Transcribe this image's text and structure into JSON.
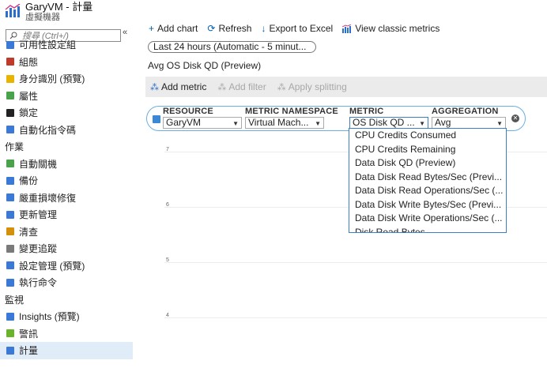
{
  "app": {
    "title": "GaryVM - 計量",
    "subtitle": "虛擬機器"
  },
  "search": {
    "placeholder": "搜尋 (Ctrl+/)"
  },
  "collapse_glyph": "«",
  "sidebar": {
    "items": [
      {
        "type": "item",
        "label": "可用性設定組",
        "icon": "availability-icon",
        "color": "#3a7ad6"
      },
      {
        "type": "item",
        "label": "組態",
        "icon": "configuration-icon",
        "color": "#c0392b"
      },
      {
        "type": "item",
        "label": "身分識別 (預覽)",
        "icon": "identity-icon",
        "color": "#e8b400"
      },
      {
        "type": "item",
        "label": "屬性",
        "icon": "properties-icon",
        "color": "#4aa24a"
      },
      {
        "type": "item",
        "label": "鎖定",
        "icon": "lock-icon",
        "color": "#222222"
      },
      {
        "type": "item",
        "label": "自動化指令碼",
        "icon": "automation-script-icon",
        "color": "#3a7ad6"
      },
      {
        "type": "group",
        "label": "作業"
      },
      {
        "type": "item",
        "label": "自動關機",
        "icon": "auto-shutdown-icon",
        "color": "#4aa24a"
      },
      {
        "type": "item",
        "label": "備份",
        "icon": "backup-icon",
        "color": "#3a7ad6"
      },
      {
        "type": "item",
        "label": "嚴重損壞修復",
        "icon": "disaster-recovery-icon",
        "color": "#3a7ad6"
      },
      {
        "type": "item",
        "label": "更新管理",
        "icon": "update-management-icon",
        "color": "#3a7ad6"
      },
      {
        "type": "item",
        "label": "清查",
        "icon": "inventory-icon",
        "color": "#d4900a"
      },
      {
        "type": "item",
        "label": "變更追蹤",
        "icon": "change-tracking-icon",
        "color": "#7a7a7a"
      },
      {
        "type": "item",
        "label": "設定管理 (預覽)",
        "icon": "configuration-management-icon",
        "color": "#3a7ad6"
      },
      {
        "type": "item",
        "label": "執行命令",
        "icon": "run-command-icon",
        "color": "#3a7ad6"
      },
      {
        "type": "group",
        "label": "監視"
      },
      {
        "type": "item",
        "label": "Insights (預覽)",
        "icon": "insights-icon",
        "color": "#3a7ad6"
      },
      {
        "type": "item",
        "label": "警訊",
        "icon": "alerts-icon",
        "color": "#6ab42c"
      },
      {
        "type": "item",
        "label": "計量",
        "icon": "metrics-icon",
        "color": "#3a7ad6",
        "active": true
      }
    ]
  },
  "toolbar": {
    "add_chart": "Add chart",
    "refresh": "Refresh",
    "export": "Export to Excel",
    "classic": "View classic metrics"
  },
  "time_range": "Last 24 hours (Automatic - 5 minut...",
  "chart_title": "Avg OS Disk QD (Preview)",
  "commands": {
    "add_metric": "Add metric",
    "add_filter": "Add filter",
    "apply_splitting": "Apply splitting"
  },
  "metric_bar": {
    "resource_label": "RESOURCE",
    "resource_value": "GaryVM",
    "namespace_label": "METRIC NAMESPACE",
    "namespace_value": "Virtual Mach...",
    "metric_label": "METRIC",
    "metric_value": "OS Disk QD ...",
    "aggregation_label": "AGGREGATION",
    "aggregation_value": "Avg"
  },
  "metric_options": [
    "CPU Credits Consumed",
    "CPU Credits Remaining",
    "Data Disk QD (Preview)",
    "Data Disk Read Bytes/Sec (Previ...",
    "Data Disk Read Operations/Sec (...",
    "Data Disk Write Bytes/Sec (Previ...",
    "Data Disk Write Operations/Sec (...",
    "Disk Read Bytes"
  ],
  "y_ticks": [
    "7",
    "6",
    "5",
    "4"
  ]
}
